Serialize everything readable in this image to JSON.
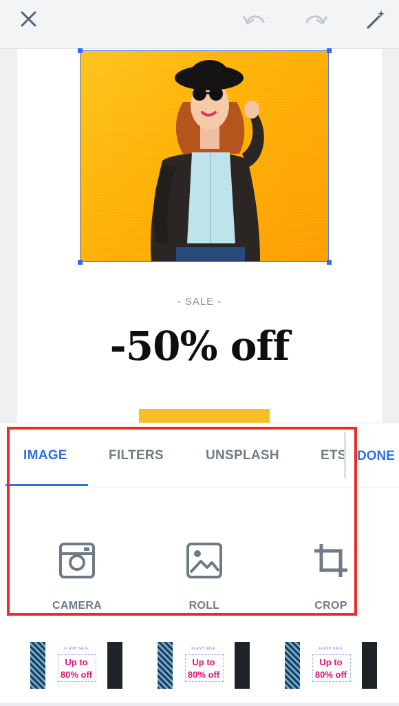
{
  "toolbar": {
    "icons": [
      "close-icon",
      "undo-icon",
      "redo-icon",
      "magic-wand-icon"
    ]
  },
  "design": {
    "photo_icon": "woman-in-sunglasses-photo",
    "sale_label": "- SALE -",
    "discount_text": "-50% off",
    "colors": {
      "photo_bg": "#ffb000",
      "cta_bar": "#f7bf22",
      "selection": "#2e6df0"
    }
  },
  "panel": {
    "tabs": [
      {
        "label": "IMAGE",
        "active": true
      },
      {
        "label": "FILTERS",
        "active": false
      },
      {
        "label": "UNSPLASH",
        "active": false
      },
      {
        "label": "ETS",
        "active": false
      }
    ],
    "done_label": "DONE",
    "tools": [
      {
        "label": "CAMERA",
        "icon": "camera-icon"
      },
      {
        "label": "ROLL",
        "icon": "image-gallery-icon"
      },
      {
        "label": "CROP",
        "icon": "crop-icon"
      }
    ],
    "accent_color": "#2f6fe4",
    "highlight_color": "#ee2b24"
  },
  "templates": [
    {
      "header": "FLASH SALE",
      "line1": "Up to",
      "line2": "80% off"
    },
    {
      "header": "FLASH SALE",
      "line1": "Up to",
      "line2": "80% off"
    },
    {
      "header": "FLASH SALE",
      "line1": "Up to",
      "line2": "80% off"
    }
  ]
}
